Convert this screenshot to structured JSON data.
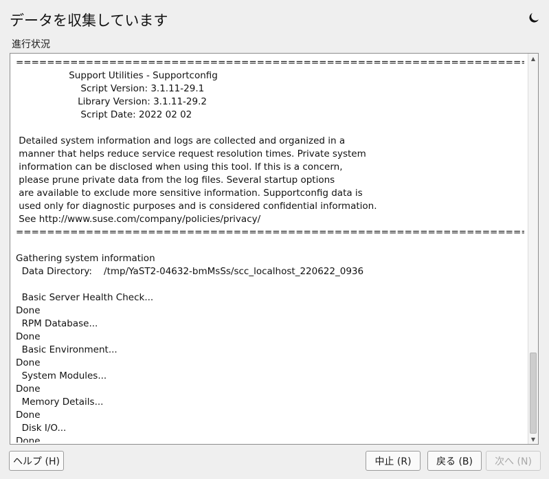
{
  "window": {
    "title": "データを収集しています",
    "progress_label": "進行状況"
  },
  "icons": {
    "theme_toggle": "moon-icon"
  },
  "log": {
    "lines": [
      "==================================================================================",
      "                  Support Utilities - Supportconfig",
      "                      Script Version: 3.1.11-29.1",
      "                     Library Version: 3.1.11-29.2",
      "                      Script Date: 2022 02 02",
      "",
      " Detailed system information and logs are collected and organized in a",
      " manner that helps reduce service request resolution times. Private system",
      " information can be disclosed when using this tool. If this is a concern,",
      " please prune private data from the log files. Several startup options",
      " are available to exclude more sensitive information. Supportconfig data is",
      " used only for diagnostic purposes and is considered confidential information.",
      " See http://www.suse.com/company/policies/privacy/",
      "==================================================================================",
      "",
      "Gathering system information",
      "  Data Directory:    /tmp/YaST2-04632-bmMsSs/scc_localhost_220622_0936",
      "",
      "  Basic Server Health Check...",
      "Done",
      "  RPM Database...",
      "Done",
      "  Basic Environment...",
      "Done",
      "  System Modules...",
      "Done",
      "  Memory Details...",
      "Done",
      "  Disk I/O...",
      "Done"
    ]
  },
  "buttons": {
    "help": "ヘルプ (H)",
    "abort": "中止 (R)",
    "back": "戻る (B)",
    "next": "次へ (N)"
  }
}
